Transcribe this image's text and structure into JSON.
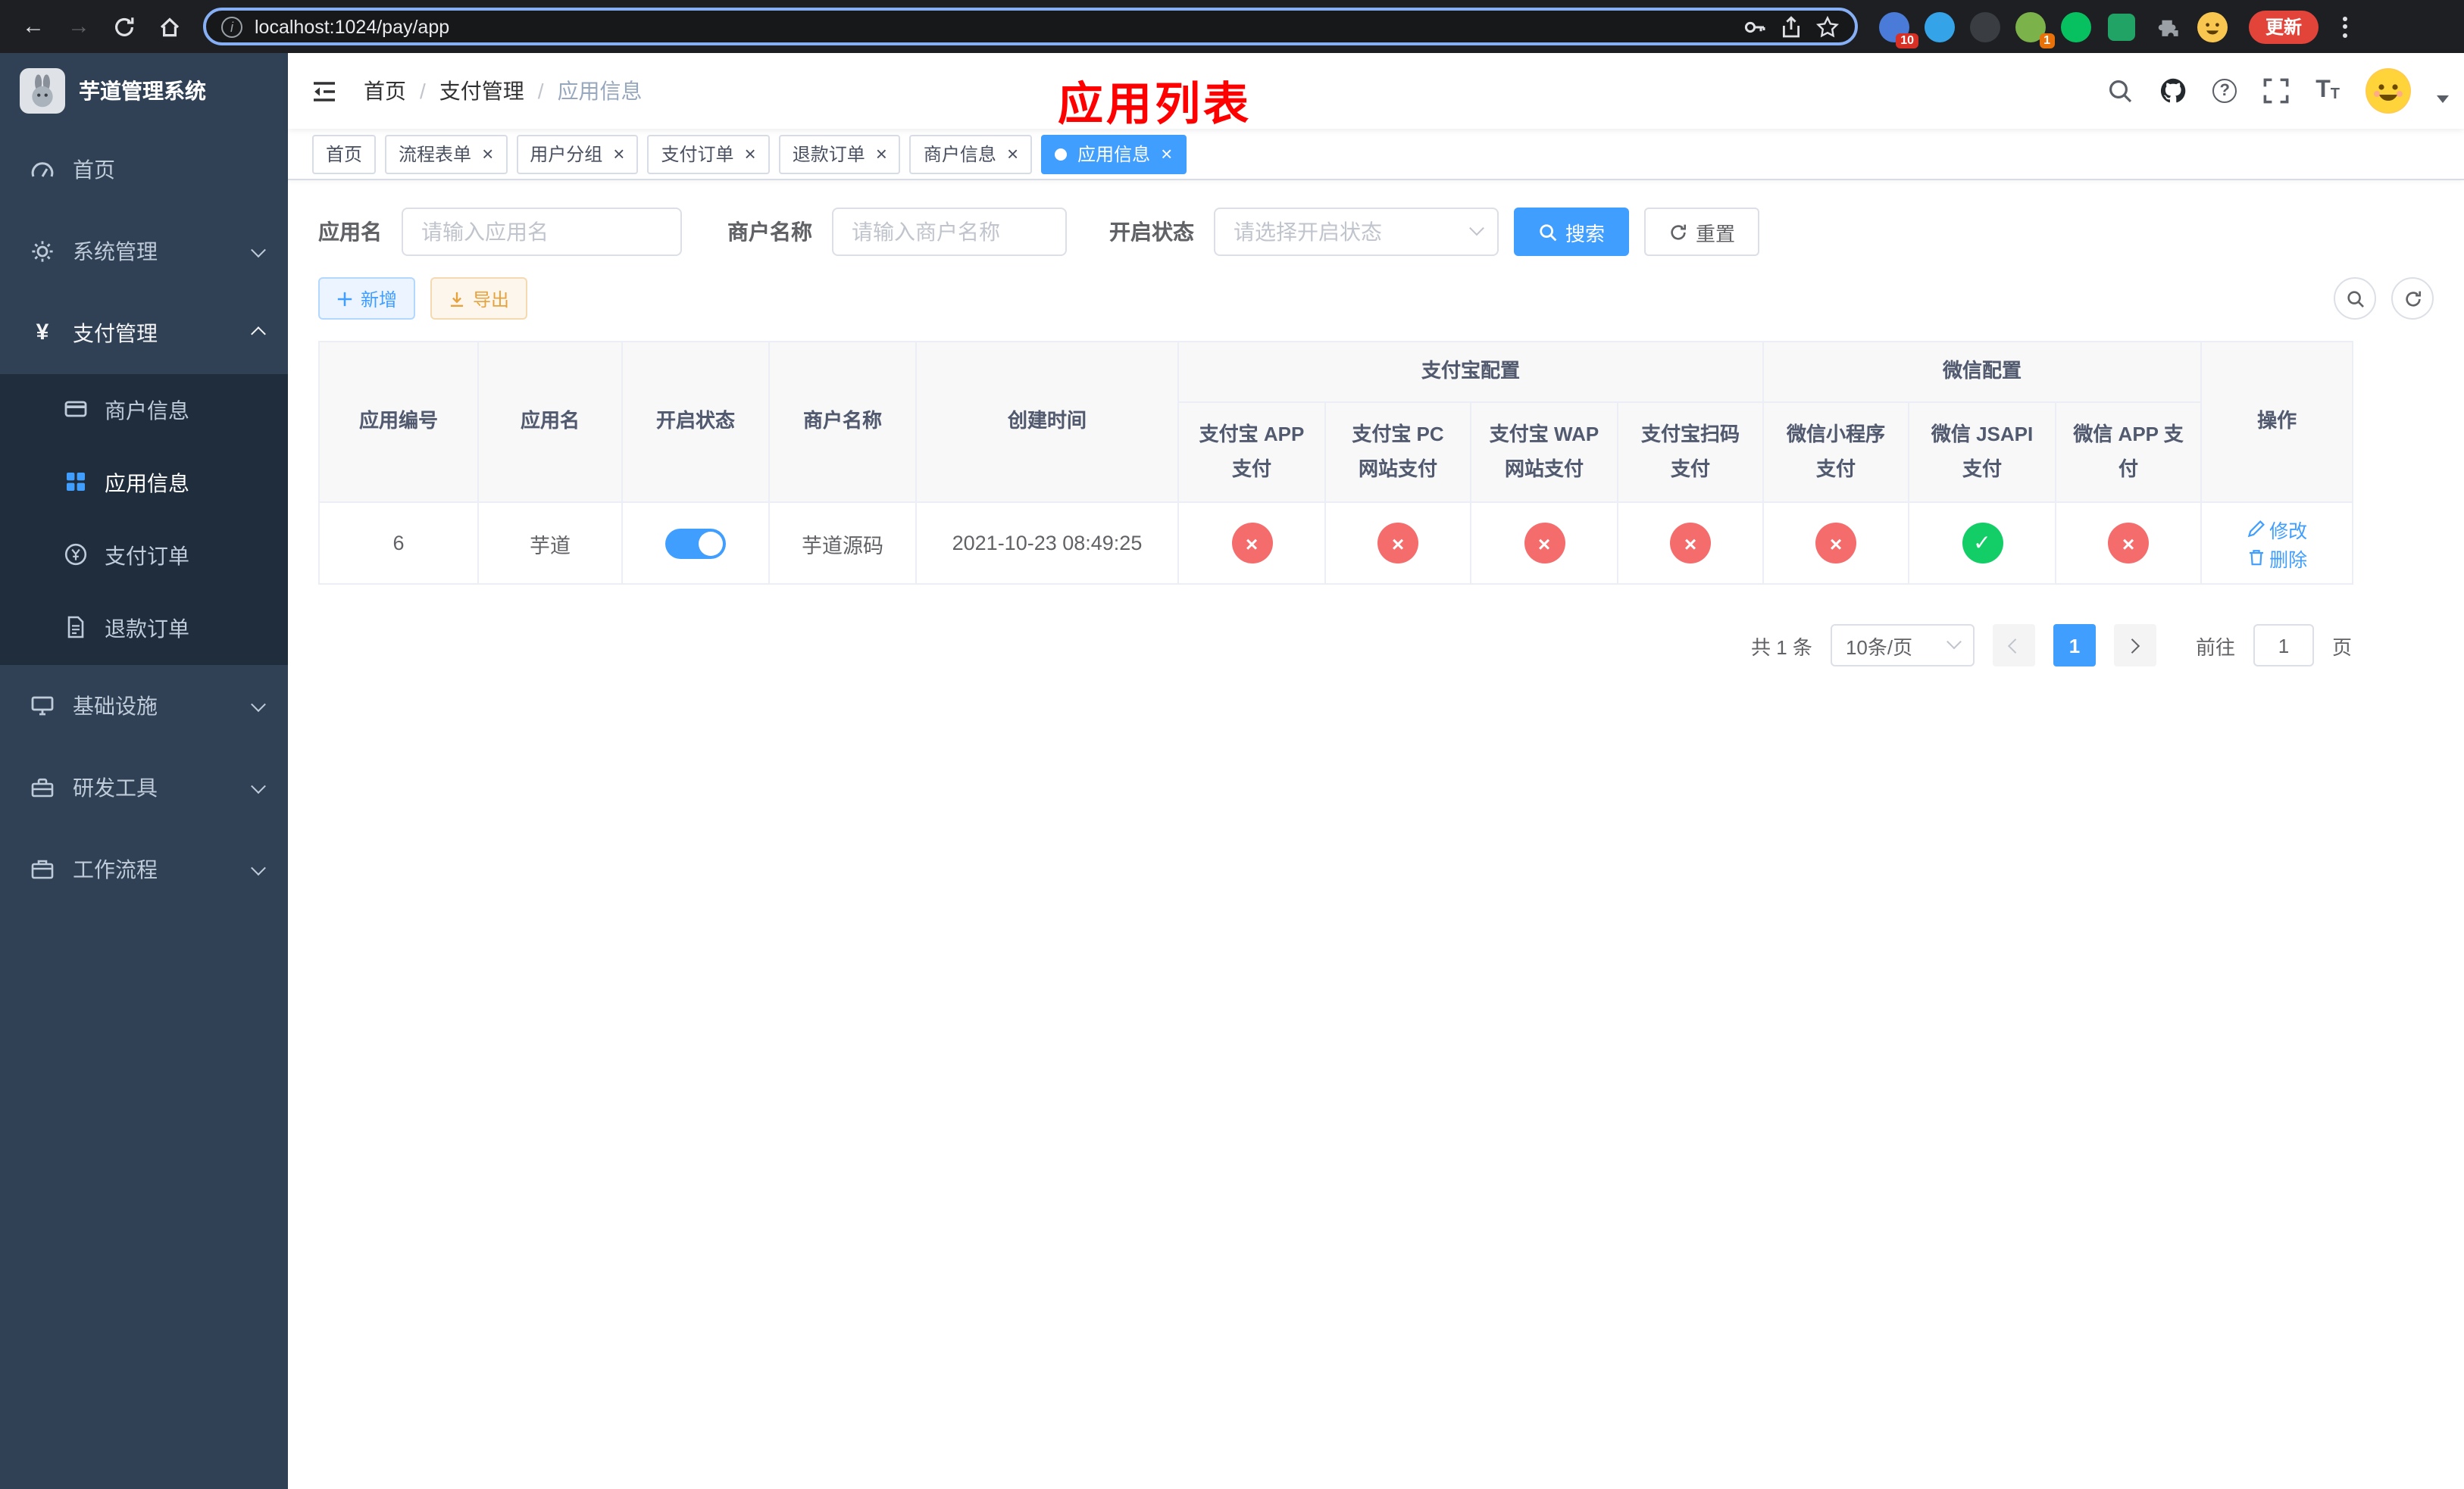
{
  "browser": {
    "url": "localhost:1024/pay/app",
    "update_label": "更新",
    "ext_badge_a": "10",
    "ext_badge_b": "1"
  },
  "app": {
    "logo_title": "芋道管理系统"
  },
  "sidebar": {
    "items": [
      {
        "label": "首页"
      },
      {
        "label": "系统管理"
      },
      {
        "label": "支付管理",
        "expanded": true
      },
      {
        "label": "基础设施"
      },
      {
        "label": "研发工具"
      },
      {
        "label": "工作流程"
      }
    ],
    "submenu": [
      {
        "label": "商户信息",
        "active": false
      },
      {
        "label": "应用信息",
        "active": true
      },
      {
        "label": "支付订单",
        "active": false
      },
      {
        "label": "退款订单",
        "active": false
      }
    ]
  },
  "header": {
    "breadcrumb": [
      "首页",
      "支付管理",
      "应用信息"
    ],
    "sep": "/",
    "annotation": "应用列表"
  },
  "tabs": [
    {
      "label": "首页",
      "closable": false,
      "active": false
    },
    {
      "label": "流程表单",
      "closable": true,
      "active": false
    },
    {
      "label": "用户分组",
      "closable": true,
      "active": false
    },
    {
      "label": "支付订单",
      "closable": true,
      "active": false
    },
    {
      "label": "退款订单",
      "closable": true,
      "active": false
    },
    {
      "label": "商户信息",
      "closable": true,
      "active": false
    },
    {
      "label": "应用信息",
      "closable": true,
      "active": true
    }
  ],
  "filters": {
    "app_name": {
      "label": "应用名",
      "placeholder": "请输入应用名"
    },
    "merchant_name": {
      "label": "商户名称",
      "placeholder": "请输入商户名称"
    },
    "status": {
      "label": "开启状态",
      "placeholder": "请选择开启状态"
    },
    "search": "搜索",
    "reset": "重置"
  },
  "toolbar": {
    "add": "新增",
    "export": "导出"
  },
  "table": {
    "columns": {
      "app_id": "应用编号",
      "app_name": "应用名",
      "status": "开启状态",
      "merchant_name": "商户名称",
      "create_time": "创建时间",
      "alipay_group": "支付宝配置",
      "wechat_group": "微信配置",
      "alipay_app": "支付宝 APP 支付",
      "alipay_pc": "支付宝 PC 网站支付",
      "alipay_wap": "支付宝 WAP 网站支付",
      "alipay_qr": "支付宝扫码支付",
      "wechat_lite": "微信小程序支付",
      "wechat_jsapi": "微信 JSAPI 支付",
      "wechat_app": "微信 APP 支付",
      "actions": "操作"
    },
    "rows": [
      {
        "app_id": "6",
        "app_name": "芋道",
        "status_on": true,
        "merchant_name": "芋道源码",
        "create_time": "2021-10-23 08:49:25",
        "alipay_app": "error",
        "alipay_pc": "error",
        "alipay_wap": "error",
        "alipay_qr": "error",
        "wechat_lite": "error",
        "wechat_jsapi": "success",
        "wechat_app": "error",
        "edit": "修改",
        "delete": "删除"
      }
    ]
  },
  "pagination": {
    "total": "共 1 条",
    "page_size": "10条/页",
    "current": "1",
    "goto_label": "前往",
    "goto_value": "1",
    "goto_suffix": "页"
  },
  "colors": {
    "primary": "#409eff",
    "success": "#13ce66",
    "danger": "#f56c6c",
    "warning": "#e6a23c",
    "sidebar_bg": "#304156",
    "submenu_bg": "#1f2d3d",
    "annotation": "#ff0000"
  }
}
